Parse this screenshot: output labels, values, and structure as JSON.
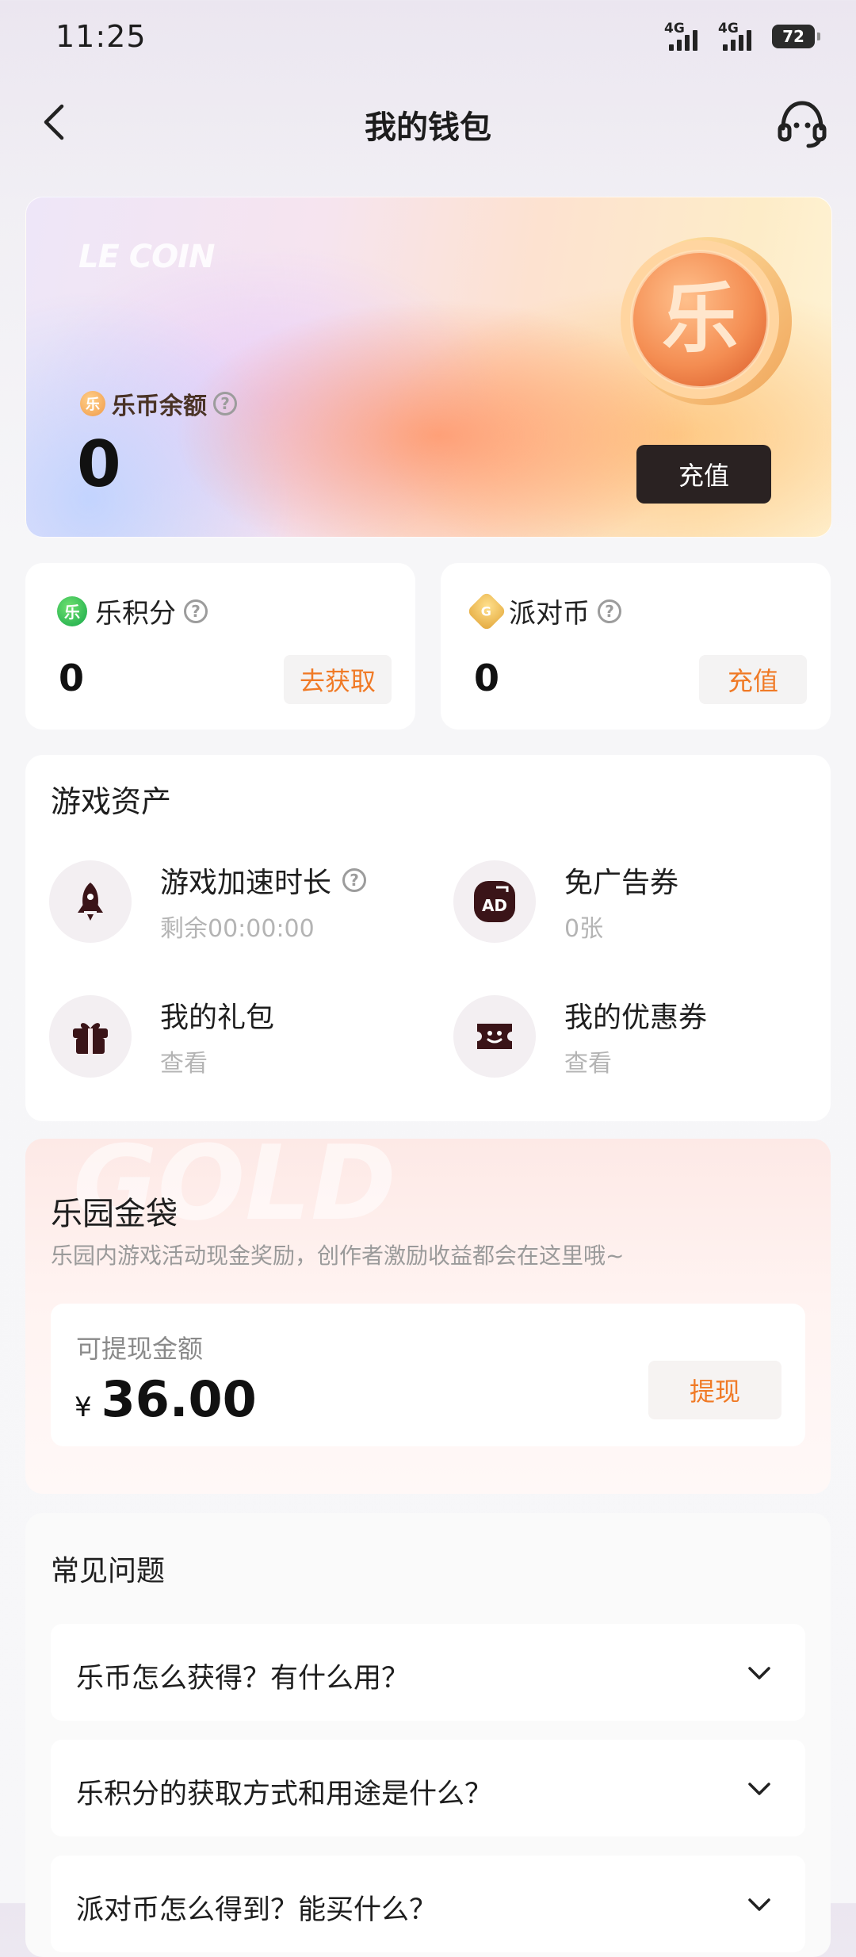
{
  "status_bar": {
    "time": "11:25",
    "network_1": "4G",
    "network_2": "4G",
    "battery": "72"
  },
  "header": {
    "title": "我的钱包",
    "back_icon": "chevron-left-icon",
    "service_icon": "headset-icon"
  },
  "coin_card": {
    "watermark": "LE COIN",
    "coin_glyph": "乐",
    "mini_coin_glyph": "乐",
    "label": "乐币余额",
    "help": "?",
    "balance": "0",
    "recharge_label": "充值"
  },
  "points_card": {
    "label": "乐积分",
    "icon_glyph": "乐",
    "help": "?",
    "value": "0",
    "action": "去获取"
  },
  "party_card": {
    "label": "派对币",
    "icon_glyph": "G",
    "help": "?",
    "value": "0",
    "action": "充值"
  },
  "game_assets": {
    "title": "游戏资产",
    "items": [
      {
        "name": "游戏加速时长",
        "sub": "剩余00:00:00",
        "help": "?",
        "icon": "rocket-icon"
      },
      {
        "name": "免广告券",
        "sub": "0张",
        "icon": "ad-icon",
        "icon_text": "AD"
      },
      {
        "name": "我的礼包",
        "sub": "查看",
        "icon": "gift-icon"
      },
      {
        "name": "我的优惠券",
        "sub": "查看",
        "icon": "coupon-icon"
      }
    ]
  },
  "gold_bag": {
    "watermark": "GOLD",
    "title": "乐园金袋",
    "desc": "乐园内游戏活动现金奖励，创作者激励收益都会在这里哦~",
    "withdraw_label": "可提现金额",
    "currency": "¥",
    "amount": "36.00",
    "withdraw_button": "提现"
  },
  "faq": {
    "title": "常见问题",
    "items": [
      {
        "q": "乐币怎么获得？有什么用？"
      },
      {
        "q": "乐积分的获取方式和用途是什么？"
      },
      {
        "q": "派对币怎么得到？能买什么？"
      }
    ]
  },
  "colors": {
    "accent_orange": "#f07a26",
    "dark_button": "#2a2222",
    "icon_dark": "#3a1418"
  }
}
